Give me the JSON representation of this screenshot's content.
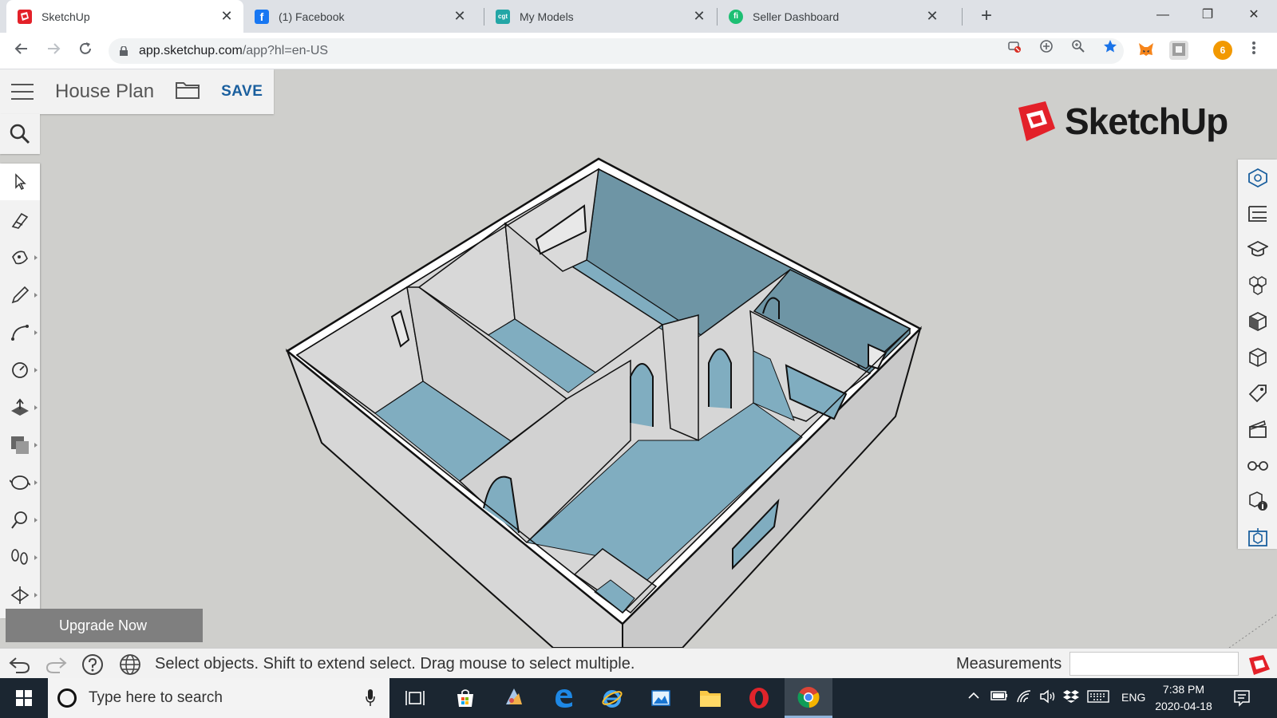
{
  "browser": {
    "tabs": [
      {
        "label": "SketchUp",
        "favicon": "sketchup-icon",
        "active": true
      },
      {
        "label": "(1) Facebook",
        "favicon": "facebook-icon",
        "active": false
      },
      {
        "label": "My Models",
        "favicon": "cgtrader-icon",
        "active": false
      },
      {
        "label": "Seller Dashboard",
        "favicon": "fiverr-icon",
        "active": false
      }
    ],
    "close_glyph": "✕",
    "new_tab_glyph": "+",
    "window_controls": {
      "minimize": "—",
      "restore": "❐",
      "close": "✕"
    },
    "url_host": "app.sketchup.com",
    "url_path": "/app?hl=en-US",
    "extension_badge": "6"
  },
  "app": {
    "document_title": "House Plan",
    "save_label": "SAVE",
    "logo_text": "SketchUp",
    "upgrade_label": "Upgrade Now",
    "left_tools": [
      "select-tool-icon",
      "eraser-tool-icon",
      "paint-bucket-tool-icon",
      "pencil-tool-icon",
      "arc-tool-icon",
      "tape-measure-tool-icon",
      "push-pull-tool-icon",
      "offset-tool-icon",
      "orbit-tool-icon",
      "position-camera-tool-icon",
      "walk-tool-icon",
      "section-plane-tool-icon"
    ],
    "right_panels": [
      "entity-info-icon",
      "outliner-icon",
      "instructor-icon",
      "components-icon",
      "materials-icon",
      "styles-icon",
      "tags-icon",
      "scenes-icon",
      "display-icon",
      "model-info-icon",
      "solid-inspector-icon"
    ],
    "colors": {
      "floor": "#80adc0",
      "wall_dark": "#6e95a5",
      "wall_light": "#dcdcdc",
      "brand_red": "#e32129",
      "save_blue": "#1a5f9e"
    }
  },
  "statusbar": {
    "message": "Select objects. Shift to extend select. Drag mouse to select multiple.",
    "measurements_label": "Measurements",
    "measurements_value": ""
  },
  "taskbar": {
    "search_placeholder": "Type here to search",
    "apps": [
      "task-view-icon",
      "store-icon",
      "paint-icon",
      "edge-icon",
      "internet-explorer-icon",
      "photos-icon",
      "file-explorer-icon",
      "opera-icon",
      "chrome-icon"
    ],
    "language": "ENG",
    "time": "7:38 PM",
    "date": "2020-04-18"
  }
}
